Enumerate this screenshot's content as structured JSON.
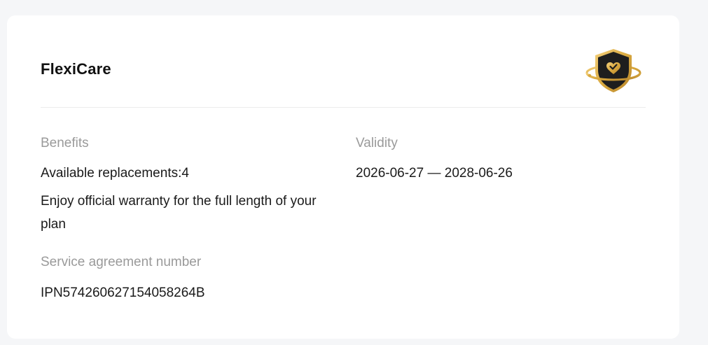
{
  "card": {
    "title": "FlexiCare",
    "badge_icon": "shield-heart-icon",
    "colors": {
      "shield_dark": "#1e1e1e",
      "gold": "#d9a93f",
      "background": "#f5f6f8",
      "muted_text": "#9a9a9a"
    }
  },
  "benefits": {
    "label": "Benefits",
    "items": [
      "Available replacements:4",
      "Enjoy official warranty for the full length of your plan"
    ]
  },
  "validity": {
    "label": "Validity",
    "value": "2026-06-27 — 2028-06-26"
  },
  "agreement": {
    "label": "Service agreement number",
    "value": "IPN574260627154058264B"
  }
}
